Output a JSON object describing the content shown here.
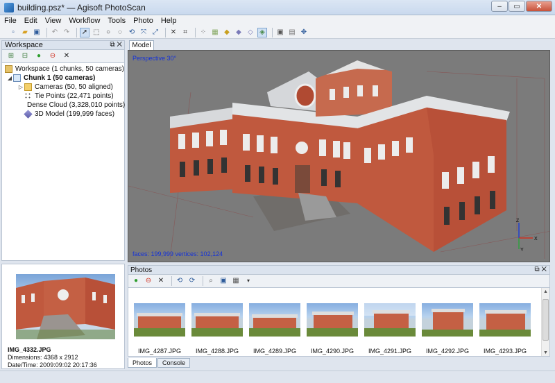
{
  "window": {
    "title": "building.psz* — Agisoft PhotoScan",
    "controls": [
      "minimize",
      "maximize",
      "close"
    ]
  },
  "menu": [
    "File",
    "Edit",
    "View",
    "Workflow",
    "Tools",
    "Photo",
    "Help"
  ],
  "workspace": {
    "title": "Workspace",
    "tree": [
      {
        "label": "Workspace (1 chunks, 50 cameras)",
        "icon": "workspace-icon",
        "level": 0
      },
      {
        "label": "Chunk 1 (50 cameras)",
        "icon": "chunk-icon",
        "level": 1,
        "bold": true
      },
      {
        "label": "Cameras (50, 50 aligned)",
        "icon": "folder-icon",
        "level": 2
      },
      {
        "label": "Tie Points (22,471 points)",
        "icon": "tie-points-icon",
        "level": 2
      },
      {
        "label": "Dense Cloud (3,328,010 points)",
        "icon": "dense-cloud-icon",
        "level": 2
      },
      {
        "label": "3D Model (199,999 faces)",
        "icon": "mesh-icon",
        "level": 2
      }
    ]
  },
  "model": {
    "tab": "Model",
    "projection": "Perspective 30°",
    "stats": "faces: 199,999 vertices: 102,124",
    "axis_labels": {
      "z": "Z",
      "x": "X",
      "y": "Y"
    }
  },
  "preview": {
    "filename": "IMG_4332.JPG",
    "dimensions": "Dimensions: 4368 x 2912",
    "datetime": "Date/Time: 2009:09:02 20:17:36"
  },
  "photos": {
    "title": "Photos",
    "thumbnails": [
      "IMG_4287.JPG",
      "IMG_4288.JPG",
      "IMG_4289.JPG",
      "IMG_4290.JPG",
      "IMG_4291.JPG",
      "IMG_4292.JPG",
      "IMG_4293.JPG"
    ],
    "tabs": [
      "Photos",
      "Console"
    ]
  },
  "colors": {
    "viewport_bg": "#7b7b7b",
    "overlay_text": "#1432d8",
    "building_brick": "#c0593e",
    "building_trim": "#eeeeee"
  }
}
